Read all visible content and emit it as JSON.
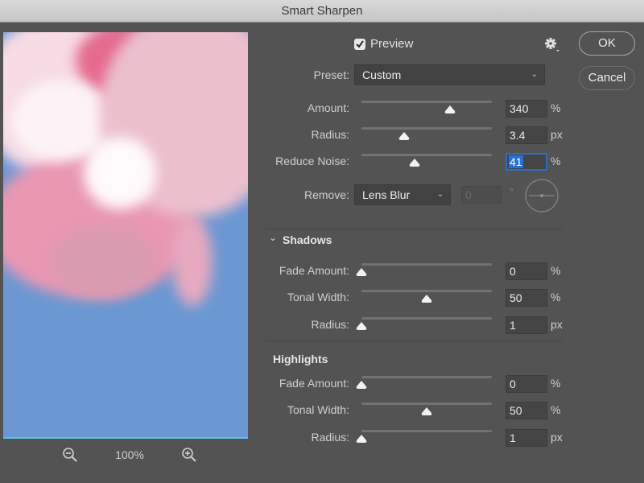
{
  "window": {
    "title": "Smart Sharpen"
  },
  "preview_panel": {
    "zoom_level": "100%",
    "zoom_out_icon": "zoom-out-icon",
    "zoom_in_icon": "zoom-in-icon"
  },
  "header": {
    "preview_label": "Preview",
    "preview_checked": true,
    "settings_icon": "gear-icon"
  },
  "buttons": {
    "ok": "OK",
    "cancel": "Cancel"
  },
  "preset": {
    "label": "Preset:",
    "value": "Custom"
  },
  "main_controls": [
    {
      "label": "Amount:",
      "value": "340",
      "unit": "%",
      "slider_fraction": 0.68
    },
    {
      "label": "Radius:",
      "value": "3.4",
      "unit": "px",
      "slider_fraction": 0.33
    },
    {
      "label": "Reduce Noise:",
      "value": "41",
      "unit": "%",
      "slider_fraction": 0.41,
      "focused": true
    }
  ],
  "remove": {
    "label": "Remove:",
    "value": "Lens Blur",
    "angle_value": "0",
    "angle_unit": "°",
    "angle_disabled": true
  },
  "shadows": {
    "title": "Shadows",
    "expanded": true,
    "controls": [
      {
        "label": "Fade Amount:",
        "value": "0",
        "unit": "%",
        "slider_fraction": 0.0
      },
      {
        "label": "Tonal Width:",
        "value": "50",
        "unit": "%",
        "slider_fraction": 0.5
      },
      {
        "label": "Radius:",
        "value": "1",
        "unit": "px",
        "slider_fraction": 0.0
      }
    ]
  },
  "highlights": {
    "title": "Highlights",
    "controls": [
      {
        "label": "Fade Amount:",
        "value": "0",
        "unit": "%",
        "slider_fraction": 0.0
      },
      {
        "label": "Tonal Width:",
        "value": "50",
        "unit": "%",
        "slider_fraction": 0.5
      },
      {
        "label": "Radius:",
        "value": "1",
        "unit": "px",
        "slider_fraction": 0.0
      }
    ]
  },
  "colors": {
    "accent": "#2f6cc8",
    "panel": "#535353",
    "sky": "#6b98d2",
    "petal": "#e9a9c1"
  }
}
